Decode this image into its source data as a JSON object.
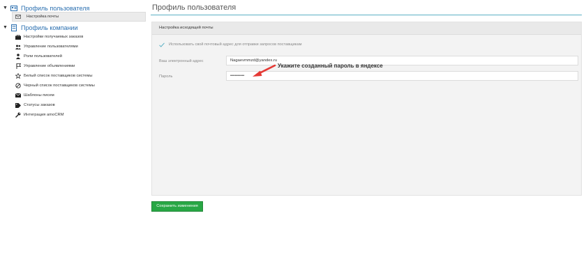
{
  "sidebar": {
    "user_profile": {
      "label": "Профиль пользователя"
    },
    "active_item": {
      "label": "Настройка почты"
    },
    "company_profile": {
      "label": "Профиль компании"
    },
    "items": [
      {
        "label": "Настройки получаемых заказов",
        "icon": "briefcase-icon"
      },
      {
        "label": "Управление пользователями",
        "icon": "users-icon"
      },
      {
        "label": "Роли пользователей",
        "icon": "user-role-icon"
      },
      {
        "label": "Управление объявлениями",
        "icon": "flag-icon"
      },
      {
        "label": "Белый список поставщиков системы",
        "icon": "star-icon"
      },
      {
        "label": "Черный список поставщиков системы",
        "icon": "ban-icon"
      },
      {
        "label": "Шаблоны писем",
        "icon": "envelope-icon"
      },
      {
        "label": "Статусы заказов",
        "icon": "tag-icon"
      },
      {
        "label": "Интеграция amoCRM",
        "icon": "wrench-icon"
      }
    ]
  },
  "page": {
    "title": "Профиль пользователя"
  },
  "panel": {
    "header": "Настройка исходящей почты",
    "use_own_email_label": "Использовать свой почтовый адрес для отправки запросов поставщикам",
    "email_label": "Ваш электронный адрес",
    "email_value": "Nagaevmmzd@yandex.ru",
    "password_label": "Пароль",
    "password_value": "••••••••••"
  },
  "annotation": {
    "text": "Укажите созданный пароль в яндексе"
  },
  "actions": {
    "save_label": "Сохранить изменения"
  },
  "colors": {
    "link": "#2a6fb0",
    "accent_rule": "#5ab0c4",
    "save": "#28a745",
    "arrow": "#e53935"
  }
}
